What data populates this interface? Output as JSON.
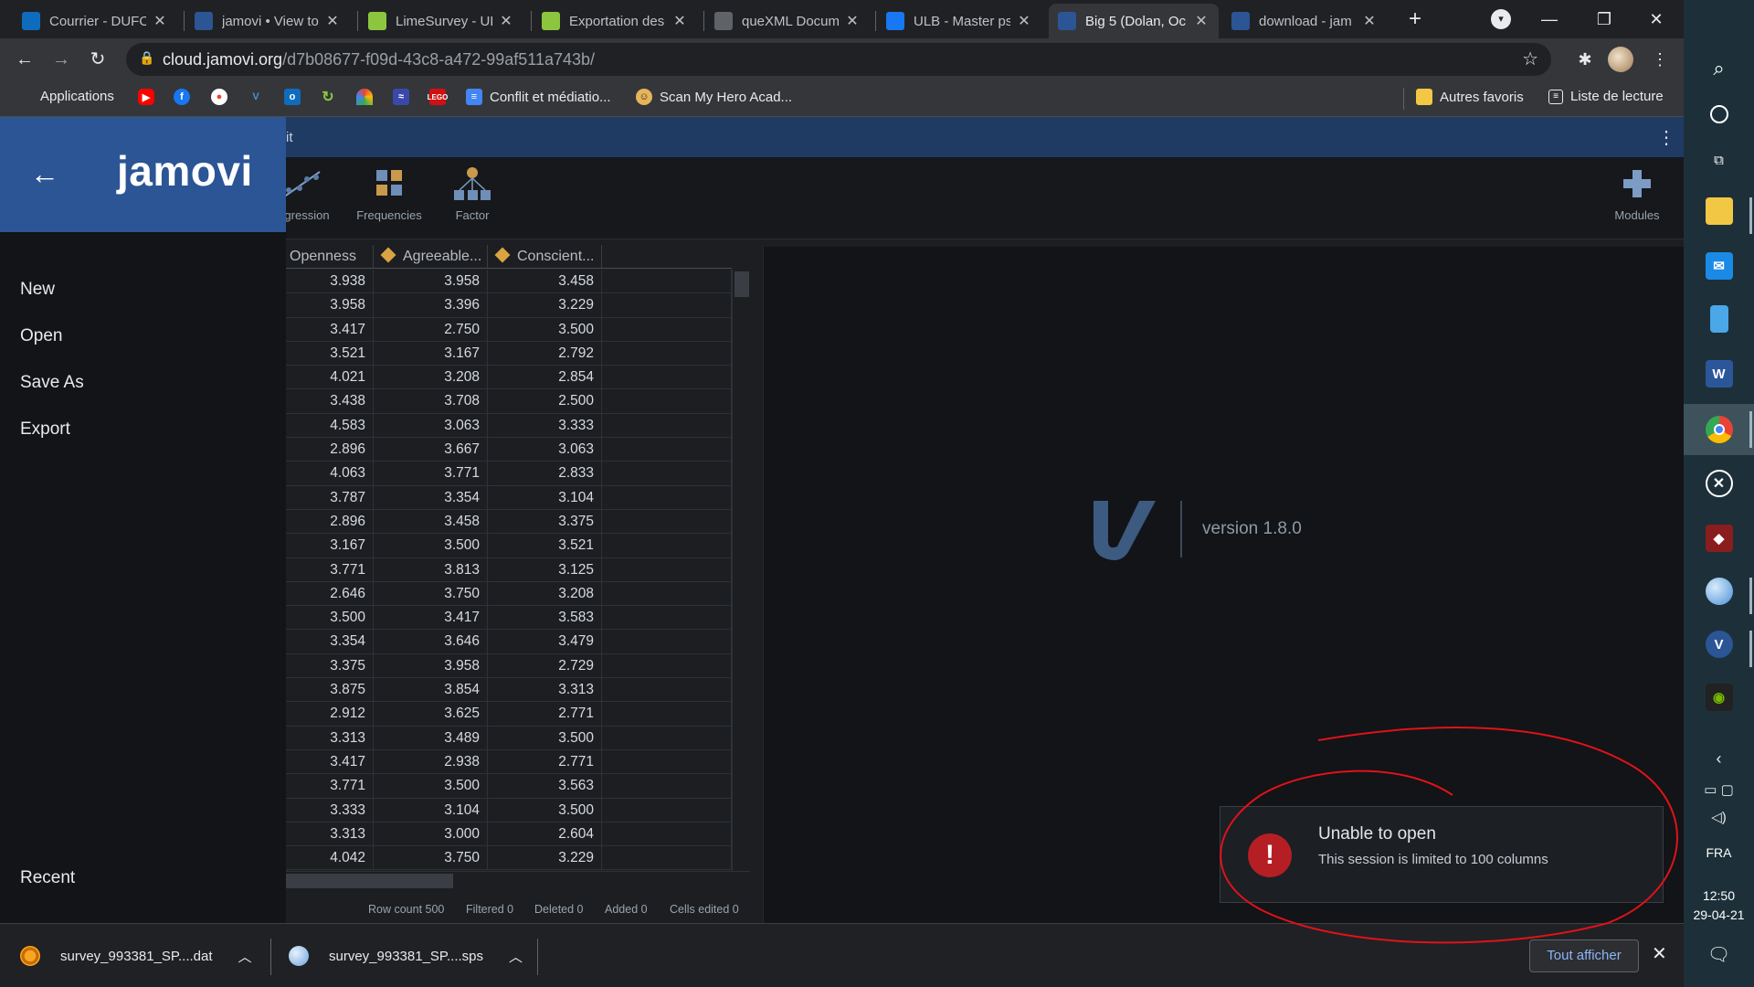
{
  "browser": {
    "tabs": [
      {
        "title": "Courrier - DUFO",
        "icon": "outlook-icon",
        "color": "#0f6cbd"
      },
      {
        "title": "jamovi • View to",
        "icon": "jamovi-icon",
        "color": "#2b5594"
      },
      {
        "title": "LimeSurvey - UL",
        "icon": "limesurvey-icon",
        "color": "#8cc63f"
      },
      {
        "title": "Exportation des",
        "icon": "limesurvey-icon",
        "color": "#8cc63f"
      },
      {
        "title": "queXML Docum",
        "icon": "globe-icon",
        "color": "#5f6368"
      },
      {
        "title": "ULB - Master ps",
        "icon": "facebook-icon",
        "color": "#1877f2"
      },
      {
        "title": "Big 5 (Dolan, Oc",
        "icon": "jamovi-icon",
        "color": "#2b5594"
      },
      {
        "title": "download - jam",
        "icon": "jamovi-icon",
        "color": "#2b5594"
      }
    ],
    "active_tab": 6,
    "url_host": "cloud.jamovi.org",
    "url_path": "/d7b08677-f09d-43c8-a472-99af511a743b/"
  },
  "bookmarks": {
    "items": [
      {
        "label": "Applications",
        "icon": "apps-grid-icon"
      },
      {
        "label": "",
        "icon": "youtube-icon"
      },
      {
        "label": "",
        "icon": "facebook-icon"
      },
      {
        "label": "",
        "icon": "maps-icon"
      },
      {
        "label": "",
        "icon": "ulb-icon"
      },
      {
        "label": "",
        "icon": "outlook-icon"
      },
      {
        "label": "",
        "icon": "limesurvey-icon"
      },
      {
        "label": "",
        "icon": "rainbow-icon"
      },
      {
        "label": "",
        "icon": "team-icon"
      },
      {
        "label": "",
        "icon": "lego-icon"
      },
      {
        "label": "Conflit et médiatio...",
        "icon": "doc-icon"
      },
      {
        "label": "Scan My Hero Acad...",
        "icon": "manga-icon"
      }
    ],
    "other_label": "Autres favoris",
    "reading_list_label": "Liste de lecture"
  },
  "app": {
    "top_fragment": "it",
    "sidebar": {
      "brand": "jamovi",
      "items": [
        "New",
        "Open",
        "Save As",
        "Export"
      ],
      "recent_label": "Recent"
    },
    "ribbon": {
      "buttons": [
        {
          "label": "gression",
          "icon": "regression-icon"
        },
        {
          "label": "Frequencies",
          "icon": "frequencies-icon"
        },
        {
          "label": "Factor",
          "icon": "factor-icon"
        }
      ],
      "modules_label": "Modules"
    },
    "grid": {
      "columns": [
        "Openness",
        "Agreeable...",
        "Conscient..."
      ],
      "rows": [
        [
          "3.938",
          "3.958",
          "3.458"
        ],
        [
          "3.958",
          "3.396",
          "3.229"
        ],
        [
          "3.417",
          "2.750",
          "3.500"
        ],
        [
          "3.521",
          "3.167",
          "2.792"
        ],
        [
          "4.021",
          "3.208",
          "2.854"
        ],
        [
          "3.438",
          "3.708",
          "2.500"
        ],
        [
          "4.583",
          "3.063",
          "3.333"
        ],
        [
          "2.896",
          "3.667",
          "3.063"
        ],
        [
          "4.063",
          "3.771",
          "2.833"
        ],
        [
          "3.787",
          "3.354",
          "3.104"
        ],
        [
          "2.896",
          "3.458",
          "3.375"
        ],
        [
          "3.167",
          "3.500",
          "3.521"
        ],
        [
          "3.771",
          "3.813",
          "3.125"
        ],
        [
          "2.646",
          "3.750",
          "3.208"
        ],
        [
          "3.500",
          "3.417",
          "3.583"
        ],
        [
          "3.354",
          "3.646",
          "3.479"
        ],
        [
          "3.375",
          "3.958",
          "2.729"
        ],
        [
          "3.875",
          "3.854",
          "3.313"
        ],
        [
          "2.912",
          "3.625",
          "2.771"
        ],
        [
          "3.313",
          "3.489",
          "3.500"
        ],
        [
          "3.417",
          "2.938",
          "2.771"
        ],
        [
          "3.771",
          "3.500",
          "3.563"
        ],
        [
          "3.333",
          "3.104",
          "3.500"
        ],
        [
          "3.313",
          "3.000",
          "2.604"
        ],
        [
          "4.042",
          "3.750",
          "3.229"
        ]
      ]
    },
    "status": {
      "row_count": "Row count 500",
      "filtered": "Filtered 0",
      "deleted": "Deleted 0",
      "added": "Added 0",
      "cells_edited": "Cells edited 0"
    },
    "version": "version 1.8.0",
    "notification": {
      "title": "Unable to open",
      "message": "This session is limited to 100 columns"
    }
  },
  "downloads": {
    "items": [
      {
        "name": "survey_993381_SP....dat",
        "icon": "dat-file-icon"
      },
      {
        "name": "survey_993381_SP....sps",
        "icon": "sps-file-icon"
      }
    ],
    "show_all": "Tout afficher"
  },
  "taskbar": {
    "lang": "FRA",
    "time": "12:50",
    "date": "29-04-21"
  },
  "colors": {
    "jamovi_blue": "#2b5594",
    "ribbon_top": "#1f3b63",
    "error_red": "#b51f23",
    "annotation_red": "#e0121a",
    "link_blue": "#8ab4f8"
  }
}
